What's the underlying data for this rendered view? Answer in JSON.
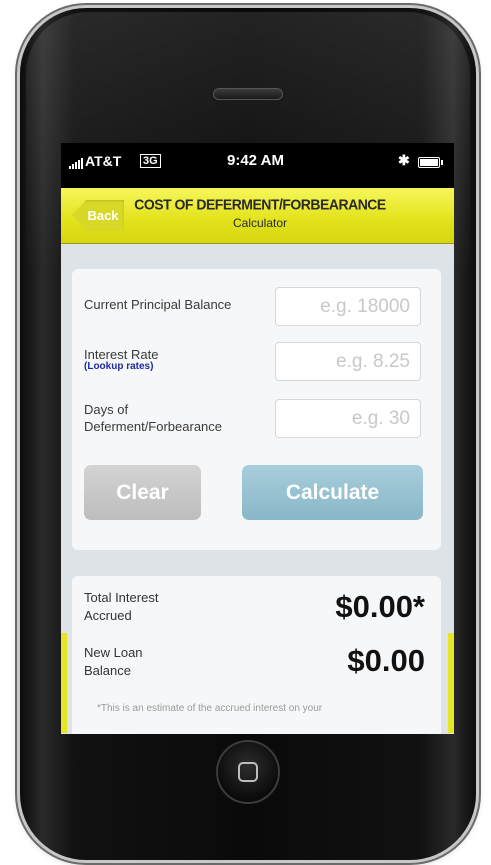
{
  "status_bar": {
    "carrier": "AT&T",
    "network": "3G",
    "time": "9:42 AM",
    "bluetooth_icon": "bluetooth-icon",
    "battery_icon": "battery-icon"
  },
  "nav": {
    "back_label": "Back",
    "title": "COST OF DEFERMENT/FORBEARANCE",
    "subtitle": "Calculator",
    "color": "#e4e41e"
  },
  "form": {
    "principal": {
      "label": "Current Principal Balance",
      "placeholder": "e.g. 18000",
      "value": ""
    },
    "rate": {
      "label": "Interest Rate",
      "link": "(Lookup rates)",
      "placeholder": "e.g. 8.25",
      "value": ""
    },
    "days": {
      "label_line1": "Days of",
      "label_line2": "Deferment/Forbearance",
      "placeholder": "e.g. 30",
      "value": ""
    },
    "clear_label": "Clear",
    "calculate_label": "Calculate",
    "calculate_color": "#88b7c8"
  },
  "results": {
    "interest_label_line1": "Total Interest",
    "interest_label_line2": "Accrued",
    "interest_value": "$0.00*",
    "balance_label_line1": "New Loan",
    "balance_label_line2": "Balance",
    "balance_value": "$0.00",
    "footnote": "*This is an estimate of the accrued interest on your"
  }
}
